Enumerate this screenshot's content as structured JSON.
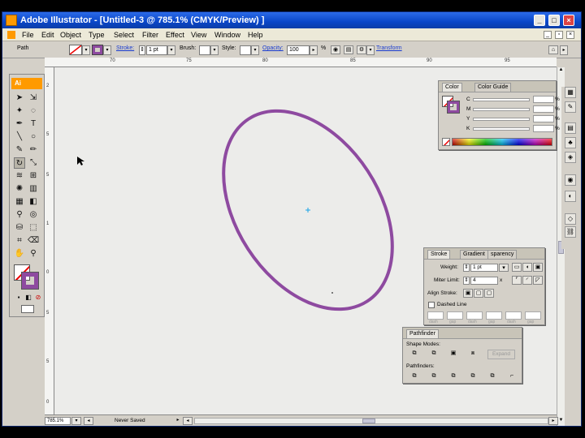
{
  "window": {
    "title": "Adobe Illustrator - [Untitled-3 @ 785.1% (CMYK/Preview) ]",
    "minimize": "_",
    "maximize": "□",
    "close": "×"
  },
  "menubar": {
    "items": [
      "File",
      "Edit",
      "Object",
      "Type",
      "Select",
      "Filter",
      "Effect",
      "View",
      "Window",
      "Help"
    ]
  },
  "control_bar": {
    "selection_label": "Path",
    "stroke_label": "Stroke:",
    "stroke_weight": "1 pt",
    "brush_label": "Brush:",
    "style_label": "Style:",
    "opacity_label": "Opacity:",
    "opacity_value": "100",
    "opacity_unit": "%",
    "transform_link": "Transform"
  },
  "rulers": {
    "horizontal": [
      "70",
      "75",
      "80",
      "85",
      "90",
      "95"
    ],
    "vertical": [
      "2",
      "5",
      "5",
      "1",
      "0",
      "5",
      "5",
      "0"
    ]
  },
  "toolbox": {
    "logo": "Ai"
  },
  "status_bar": {
    "zoom": "785.1%",
    "status_text": "Never Saved"
  },
  "color_panel": {
    "tabs": [
      "Color",
      "Color Guide"
    ],
    "channels": [
      "C",
      "M",
      "Y",
      "K"
    ],
    "percent": "%"
  },
  "stroke_panel": {
    "tabs": [
      "Stroke",
      "Gradient",
      "sparency"
    ],
    "weight_label": "Weight:",
    "weight_value": "1 pt",
    "miter_label": "Miter Limit:",
    "miter_value": "4",
    "miter_unit": "x",
    "align_label": "Align Stroke:",
    "dashed_label": "Dashed Line",
    "dash_labels": [
      "dash",
      "gap",
      "dash",
      "gap",
      "dash",
      "gap"
    ]
  },
  "pathfinder_panel": {
    "tab": "Pathfinder",
    "shape_modes_label": "Shape Modes:",
    "expand_label": "Expand",
    "pathfinders_label": "Pathfinders:"
  },
  "artwork": {
    "stroke_color": "#8e4aa0",
    "center_point_color": "#1aa3e8"
  }
}
